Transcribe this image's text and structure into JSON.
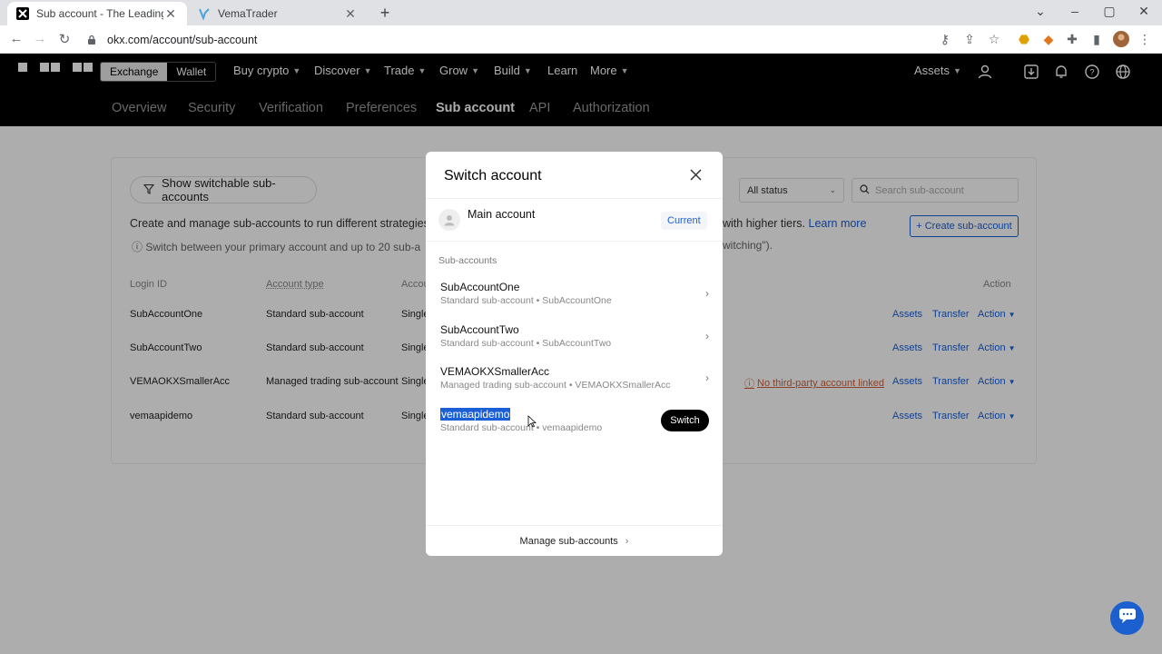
{
  "browser": {
    "tabs": [
      {
        "title": "Sub account - The Leading Glob",
        "active": true
      },
      {
        "title": "VemaTrader",
        "active": false
      }
    ],
    "url": "okx.com/account/sub-account"
  },
  "header": {
    "segment": [
      "Exchange",
      "Wallet"
    ],
    "nav": [
      "Buy crypto",
      "Discover",
      "Trade",
      "Grow",
      "Build",
      "Learn",
      "More"
    ],
    "assets_label": "Assets",
    "subnav": [
      "Overview",
      "Security",
      "Verification",
      "Preferences",
      "Sub account",
      "API",
      "Authorization"
    ],
    "subnav_active": "Sub account"
  },
  "page": {
    "filter_button": "Show switchable sub-accounts",
    "status_select": "All status",
    "search_placeholder": "Search sub-account",
    "description_left": "Create and manage sub-accounts to run different strategies a",
    "description_right": "with higher tiers.",
    "learn_more": "Learn more",
    "note_left": "Switch between your primary account and up to 20 sub-a",
    "note_right": "witching\").",
    "create_button": "+ Create sub-account",
    "columns": {
      "login_id": "Login ID",
      "account_type": "Account type",
      "account": "Accou",
      "action": "Action"
    },
    "rows": [
      {
        "login": "SubAccountOne",
        "type": "Standard sub-account",
        "mode": "Single",
        "links": [
          "Assets",
          "Transfer",
          "Action"
        ]
      },
      {
        "login": "SubAccountTwo",
        "type": "Standard sub-account",
        "mode": "Single",
        "links": [
          "Assets",
          "Transfer",
          "Action"
        ]
      },
      {
        "login": "VEMAOKXSmallerAcc",
        "type": "Managed trading sub-account",
        "mode": "Single",
        "warning": "No third-party account linked",
        "links": [
          "Assets",
          "Transfer",
          "Action"
        ]
      },
      {
        "login": "vemaapidemo",
        "type": "Standard sub-account",
        "mode": "Single",
        "links": [
          "Assets",
          "Transfer",
          "Action"
        ]
      }
    ]
  },
  "modal": {
    "title": "Switch account",
    "main_account": "Main account",
    "current_badge": "Current",
    "section_label": "Sub-accounts",
    "items": [
      {
        "name": "SubAccountOne",
        "sub": "Standard sub-account • SubAccountOne"
      },
      {
        "name": "SubAccountTwo",
        "sub": "Standard sub-account • SubAccountTwo"
      },
      {
        "name": "VEMAOKXSmallerAcc",
        "sub": "Managed trading sub-account • VEMAOKXSmallerAcc"
      },
      {
        "name": "vemaapidemo",
        "sub": "Standard sub-account • vemaapidemo"
      }
    ],
    "switch_button": "Switch",
    "footer": "Manage sub-accounts"
  },
  "colors": {
    "accent": "#1a5fd6",
    "header_bg": "#000000",
    "warning": "#d0603b",
    "chat": "#1c5fcf"
  }
}
